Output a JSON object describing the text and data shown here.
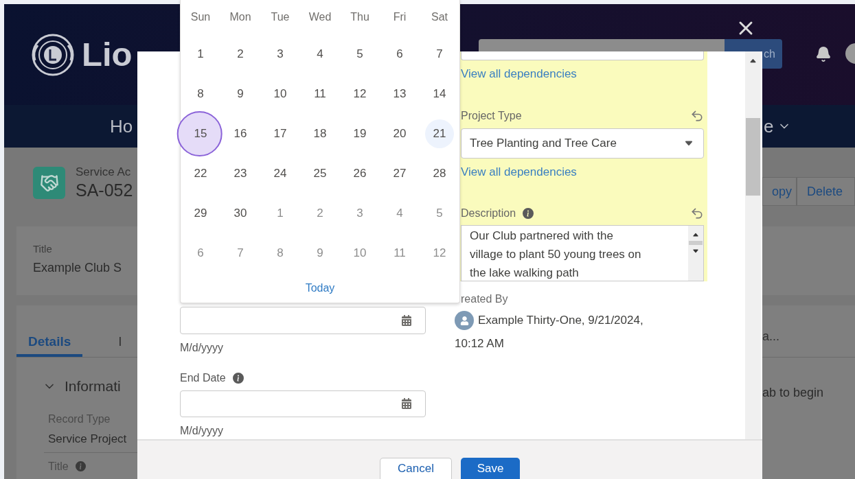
{
  "header": {
    "logo_text": "Lio",
    "search_button": "ch"
  },
  "nav": {
    "left_item": "Ho",
    "right_item": "e"
  },
  "record": {
    "object_label": "Service Ac",
    "record_name": "SA-052",
    "actions": [
      "opy",
      "Delete"
    ]
  },
  "highlights": {
    "label": "Title",
    "value": "Example Club S"
  },
  "tabs": [
    {
      "label": "Details",
      "selected": true
    },
    {
      "label": "I",
      "selected": false
    }
  ],
  "tabs_right": "a...",
  "section": {
    "title": "Informati",
    "expanded": true
  },
  "fields": [
    {
      "label": "Record Type",
      "value": "Service Project"
    }
  ],
  "next_field_label": "Title",
  "right_hint": "ab to begin",
  "modal": {
    "calendar": {
      "weekdays": [
        "Sun",
        "Mon",
        "Tue",
        "Wed",
        "Thu",
        "Fri",
        "Sat"
      ],
      "weeks": [
        [
          {
            "label": "1",
            "adjacent_month": false,
            "selected": false,
            "today": false
          },
          {
            "label": "2",
            "adjacent_month": false,
            "selected": false,
            "today": false
          },
          {
            "label": "3",
            "adjacent_month": false,
            "selected": false,
            "today": false
          },
          {
            "label": "4",
            "adjacent_month": false,
            "selected": false,
            "today": false
          },
          {
            "label": "5",
            "adjacent_month": false,
            "selected": false,
            "today": false
          },
          {
            "label": "6",
            "adjacent_month": false,
            "selected": false,
            "today": false
          },
          {
            "label": "7",
            "adjacent_month": false,
            "selected": false,
            "today": false
          }
        ],
        [
          {
            "label": "8",
            "adjacent_month": false,
            "selected": false,
            "today": false
          },
          {
            "label": "9",
            "adjacent_month": false,
            "selected": false,
            "today": false
          },
          {
            "label": "10",
            "adjacent_month": false,
            "selected": false,
            "today": false
          },
          {
            "label": "11",
            "adjacent_month": false,
            "selected": false,
            "today": false
          },
          {
            "label": "12",
            "adjacent_month": false,
            "selected": false,
            "today": false
          },
          {
            "label": "13",
            "adjacent_month": false,
            "selected": false,
            "today": false
          },
          {
            "label": "14",
            "adjacent_month": false,
            "selected": false,
            "today": false
          }
        ],
        [
          {
            "label": "15",
            "adjacent_month": false,
            "selected": true,
            "today": false
          },
          {
            "label": "16",
            "adjacent_month": false,
            "selected": false,
            "today": false
          },
          {
            "label": "17",
            "adjacent_month": false,
            "selected": false,
            "today": false
          },
          {
            "label": "18",
            "adjacent_month": false,
            "selected": false,
            "today": false
          },
          {
            "label": "19",
            "adjacent_month": false,
            "selected": false,
            "today": false
          },
          {
            "label": "20",
            "adjacent_month": false,
            "selected": false,
            "today": false
          },
          {
            "label": "21",
            "adjacent_month": false,
            "selected": false,
            "today": true
          }
        ],
        [
          {
            "label": "22",
            "adjacent_month": false,
            "selected": false,
            "today": false
          },
          {
            "label": "23",
            "adjacent_month": false,
            "selected": false,
            "today": false
          },
          {
            "label": "24",
            "adjacent_month": false,
            "selected": false,
            "today": false
          },
          {
            "label": "25",
            "adjacent_month": false,
            "selected": false,
            "today": false
          },
          {
            "label": "26",
            "adjacent_month": false,
            "selected": false,
            "today": false
          },
          {
            "label": "27",
            "adjacent_month": false,
            "selected": false,
            "today": false
          },
          {
            "label": "28",
            "adjacent_month": false,
            "selected": false,
            "today": false
          }
        ],
        [
          {
            "label": "29",
            "adjacent_month": false,
            "selected": false,
            "today": false
          },
          {
            "label": "30",
            "adjacent_month": false,
            "selected": false,
            "today": false
          },
          {
            "label": "1",
            "adjacent_month": true,
            "selected": false,
            "today": false
          },
          {
            "label": "2",
            "adjacent_month": true,
            "selected": false,
            "today": false
          },
          {
            "label": "3",
            "adjacent_month": true,
            "selected": false,
            "today": false
          },
          {
            "label": "4",
            "adjacent_month": true,
            "selected": false,
            "today": false
          },
          {
            "label": "5",
            "adjacent_month": true,
            "selected": false,
            "today": false
          }
        ],
        [
          {
            "label": "6",
            "adjacent_month": true,
            "selected": false,
            "today": false
          },
          {
            "label": "7",
            "adjacent_month": true,
            "selected": false,
            "today": false
          },
          {
            "label": "8",
            "adjacent_month": true,
            "selected": false,
            "today": false
          },
          {
            "label": "9",
            "adjacent_month": true,
            "selected": false,
            "today": false
          },
          {
            "label": "10",
            "adjacent_month": true,
            "selected": false,
            "today": false
          },
          {
            "label": "11",
            "adjacent_month": true,
            "selected": false,
            "today": false
          },
          {
            "label": "12",
            "adjacent_month": true,
            "selected": false,
            "today": false
          }
        ]
      ],
      "today_link": "Today"
    },
    "start_date": {
      "format_hint": "M/d/yyyy"
    },
    "end_date": {
      "label": "End Date",
      "format_hint": "M/d/yyyy"
    },
    "dependency_link": "View all dependencies",
    "project_type": {
      "label": "Project Type",
      "value": "Tree Planting and Tree Care",
      "dependency_link": "View all dependencies"
    },
    "description": {
      "label": "Description",
      "lines": [
        "Our Club partnered with the",
        "village to plant 50 young trees on",
        "the lake walking path"
      ]
    },
    "created_by": {
      "label": "reated By",
      "value_lines": [
        "Example Thirty-One, 9/21/2024,",
        "10:12 AM"
      ]
    },
    "buttons": {
      "cancel": "Cancel",
      "save": "Save"
    }
  }
}
